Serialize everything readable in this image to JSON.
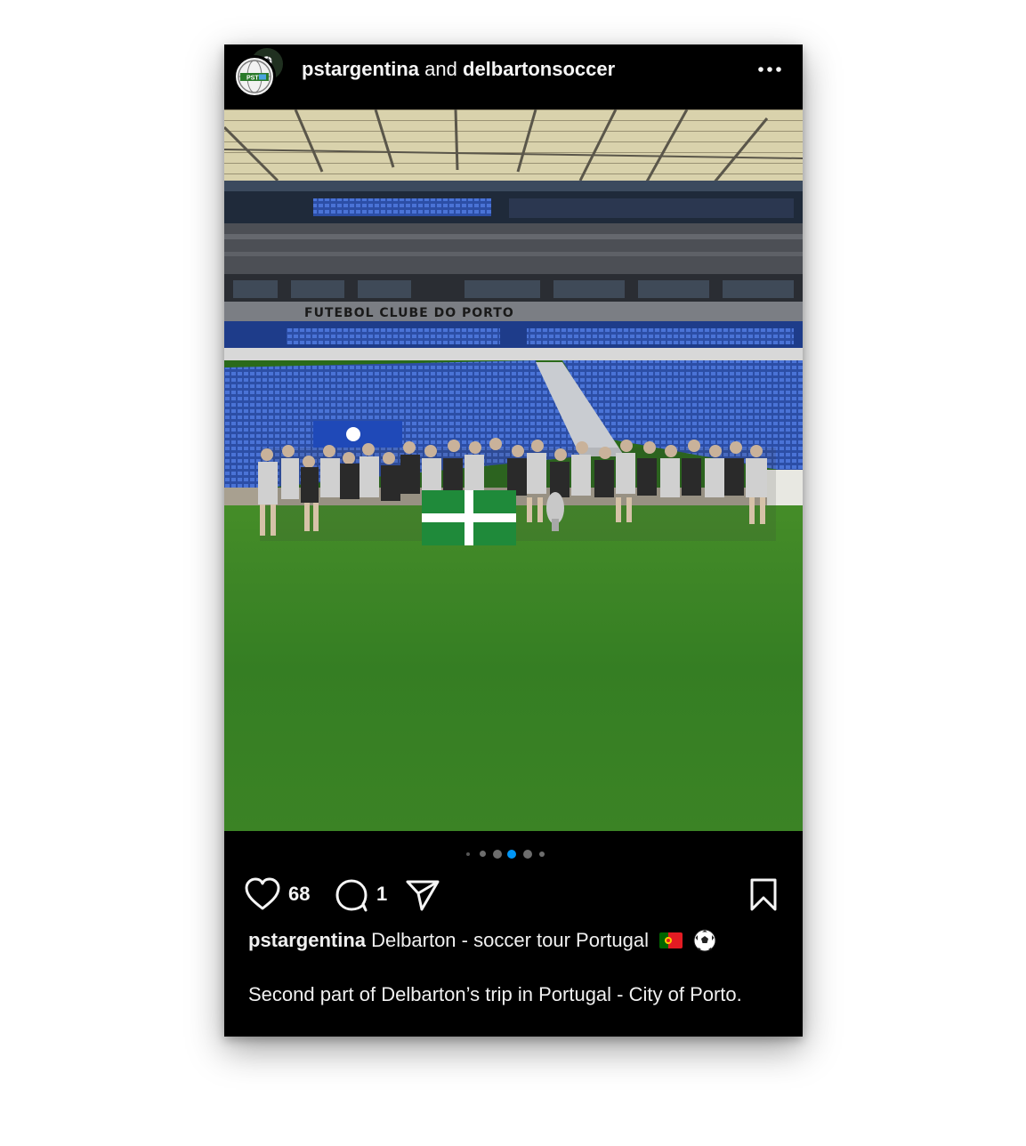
{
  "post": {
    "author_primary": "pstargentina",
    "connector": "and",
    "author_secondary": "delbartonsoccer",
    "avatar_badge_text": "PST",
    "more_icon": "more-horizontal-icon"
  },
  "photo": {
    "stadium_sign": "FUTEBOL CLUBE DO PORTO"
  },
  "carousel": {
    "total": 6,
    "active_index": 3,
    "active_color": "#0095f6"
  },
  "actions": {
    "likes": "68",
    "comments": "1",
    "like_icon": "heart-icon",
    "comment_icon": "comment-icon",
    "share_icon": "send-icon",
    "save_icon": "bookmark-icon"
  },
  "caption": {
    "username": "pstargentina",
    "headline": "Delbarton - soccer tour Portugal",
    "emojis": [
      "portugal-flag-emoji",
      "soccer-ball-emoji"
    ],
    "body": "Second part of Delbarton’s trip in Portugal - City of Porto."
  },
  "colors": {
    "background": "#000000",
    "text": "#f5f5f5",
    "accent": "#0095f6"
  }
}
